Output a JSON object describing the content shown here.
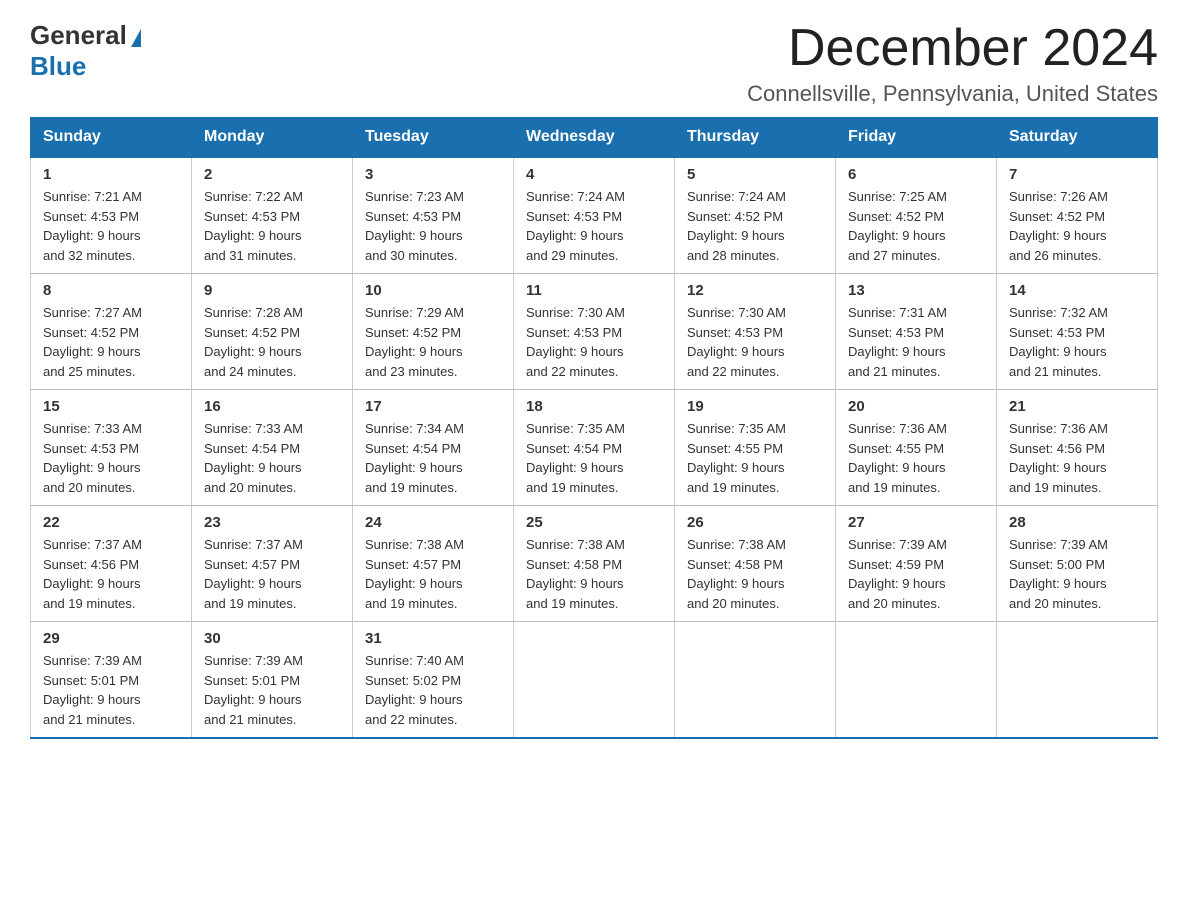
{
  "logo": {
    "general": "General",
    "blue": "Blue"
  },
  "title": {
    "month_year": "December 2024",
    "location": "Connellsville, Pennsylvania, United States"
  },
  "headers": [
    "Sunday",
    "Monday",
    "Tuesday",
    "Wednesday",
    "Thursday",
    "Friday",
    "Saturday"
  ],
  "weeks": [
    [
      {
        "day": "1",
        "sunrise": "Sunrise: 7:21 AM",
        "sunset": "Sunset: 4:53 PM",
        "daylight": "Daylight: 9 hours",
        "daylight2": "and 32 minutes."
      },
      {
        "day": "2",
        "sunrise": "Sunrise: 7:22 AM",
        "sunset": "Sunset: 4:53 PM",
        "daylight": "Daylight: 9 hours",
        "daylight2": "and 31 minutes."
      },
      {
        "day": "3",
        "sunrise": "Sunrise: 7:23 AM",
        "sunset": "Sunset: 4:53 PM",
        "daylight": "Daylight: 9 hours",
        "daylight2": "and 30 minutes."
      },
      {
        "day": "4",
        "sunrise": "Sunrise: 7:24 AM",
        "sunset": "Sunset: 4:53 PM",
        "daylight": "Daylight: 9 hours",
        "daylight2": "and 29 minutes."
      },
      {
        "day": "5",
        "sunrise": "Sunrise: 7:24 AM",
        "sunset": "Sunset: 4:52 PM",
        "daylight": "Daylight: 9 hours",
        "daylight2": "and 28 minutes."
      },
      {
        "day": "6",
        "sunrise": "Sunrise: 7:25 AM",
        "sunset": "Sunset: 4:52 PM",
        "daylight": "Daylight: 9 hours",
        "daylight2": "and 27 minutes."
      },
      {
        "day": "7",
        "sunrise": "Sunrise: 7:26 AM",
        "sunset": "Sunset: 4:52 PM",
        "daylight": "Daylight: 9 hours",
        "daylight2": "and 26 minutes."
      }
    ],
    [
      {
        "day": "8",
        "sunrise": "Sunrise: 7:27 AM",
        "sunset": "Sunset: 4:52 PM",
        "daylight": "Daylight: 9 hours",
        "daylight2": "and 25 minutes."
      },
      {
        "day": "9",
        "sunrise": "Sunrise: 7:28 AM",
        "sunset": "Sunset: 4:52 PM",
        "daylight": "Daylight: 9 hours",
        "daylight2": "and 24 minutes."
      },
      {
        "day": "10",
        "sunrise": "Sunrise: 7:29 AM",
        "sunset": "Sunset: 4:52 PM",
        "daylight": "Daylight: 9 hours",
        "daylight2": "and 23 minutes."
      },
      {
        "day": "11",
        "sunrise": "Sunrise: 7:30 AM",
        "sunset": "Sunset: 4:53 PM",
        "daylight": "Daylight: 9 hours",
        "daylight2": "and 22 minutes."
      },
      {
        "day": "12",
        "sunrise": "Sunrise: 7:30 AM",
        "sunset": "Sunset: 4:53 PM",
        "daylight": "Daylight: 9 hours",
        "daylight2": "and 22 minutes."
      },
      {
        "day": "13",
        "sunrise": "Sunrise: 7:31 AM",
        "sunset": "Sunset: 4:53 PM",
        "daylight": "Daylight: 9 hours",
        "daylight2": "and 21 minutes."
      },
      {
        "day": "14",
        "sunrise": "Sunrise: 7:32 AM",
        "sunset": "Sunset: 4:53 PM",
        "daylight": "Daylight: 9 hours",
        "daylight2": "and 21 minutes."
      }
    ],
    [
      {
        "day": "15",
        "sunrise": "Sunrise: 7:33 AM",
        "sunset": "Sunset: 4:53 PM",
        "daylight": "Daylight: 9 hours",
        "daylight2": "and 20 minutes."
      },
      {
        "day": "16",
        "sunrise": "Sunrise: 7:33 AM",
        "sunset": "Sunset: 4:54 PM",
        "daylight": "Daylight: 9 hours",
        "daylight2": "and 20 minutes."
      },
      {
        "day": "17",
        "sunrise": "Sunrise: 7:34 AM",
        "sunset": "Sunset: 4:54 PM",
        "daylight": "Daylight: 9 hours",
        "daylight2": "and 19 minutes."
      },
      {
        "day": "18",
        "sunrise": "Sunrise: 7:35 AM",
        "sunset": "Sunset: 4:54 PM",
        "daylight": "Daylight: 9 hours",
        "daylight2": "and 19 minutes."
      },
      {
        "day": "19",
        "sunrise": "Sunrise: 7:35 AM",
        "sunset": "Sunset: 4:55 PM",
        "daylight": "Daylight: 9 hours",
        "daylight2": "and 19 minutes."
      },
      {
        "day": "20",
        "sunrise": "Sunrise: 7:36 AM",
        "sunset": "Sunset: 4:55 PM",
        "daylight": "Daylight: 9 hours",
        "daylight2": "and 19 minutes."
      },
      {
        "day": "21",
        "sunrise": "Sunrise: 7:36 AM",
        "sunset": "Sunset: 4:56 PM",
        "daylight": "Daylight: 9 hours",
        "daylight2": "and 19 minutes."
      }
    ],
    [
      {
        "day": "22",
        "sunrise": "Sunrise: 7:37 AM",
        "sunset": "Sunset: 4:56 PM",
        "daylight": "Daylight: 9 hours",
        "daylight2": "and 19 minutes."
      },
      {
        "day": "23",
        "sunrise": "Sunrise: 7:37 AM",
        "sunset": "Sunset: 4:57 PM",
        "daylight": "Daylight: 9 hours",
        "daylight2": "and 19 minutes."
      },
      {
        "day": "24",
        "sunrise": "Sunrise: 7:38 AM",
        "sunset": "Sunset: 4:57 PM",
        "daylight": "Daylight: 9 hours",
        "daylight2": "and 19 minutes."
      },
      {
        "day": "25",
        "sunrise": "Sunrise: 7:38 AM",
        "sunset": "Sunset: 4:58 PM",
        "daylight": "Daylight: 9 hours",
        "daylight2": "and 19 minutes."
      },
      {
        "day": "26",
        "sunrise": "Sunrise: 7:38 AM",
        "sunset": "Sunset: 4:58 PM",
        "daylight": "Daylight: 9 hours",
        "daylight2": "and 20 minutes."
      },
      {
        "day": "27",
        "sunrise": "Sunrise: 7:39 AM",
        "sunset": "Sunset: 4:59 PM",
        "daylight": "Daylight: 9 hours",
        "daylight2": "and 20 minutes."
      },
      {
        "day": "28",
        "sunrise": "Sunrise: 7:39 AM",
        "sunset": "Sunset: 5:00 PM",
        "daylight": "Daylight: 9 hours",
        "daylight2": "and 20 minutes."
      }
    ],
    [
      {
        "day": "29",
        "sunrise": "Sunrise: 7:39 AM",
        "sunset": "Sunset: 5:01 PM",
        "daylight": "Daylight: 9 hours",
        "daylight2": "and 21 minutes."
      },
      {
        "day": "30",
        "sunrise": "Sunrise: 7:39 AM",
        "sunset": "Sunset: 5:01 PM",
        "daylight": "Daylight: 9 hours",
        "daylight2": "and 21 minutes."
      },
      {
        "day": "31",
        "sunrise": "Sunrise: 7:40 AM",
        "sunset": "Sunset: 5:02 PM",
        "daylight": "Daylight: 9 hours",
        "daylight2": "and 22 minutes."
      },
      null,
      null,
      null,
      null
    ]
  ]
}
